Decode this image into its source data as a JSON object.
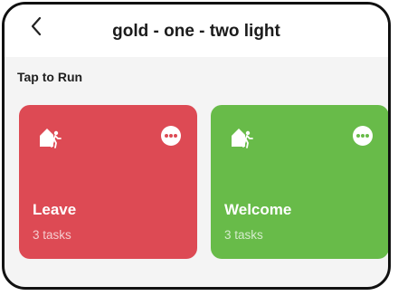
{
  "header": {
    "title": "gold - one - two light",
    "back_icon": "chevron-left-icon"
  },
  "section": {
    "label": "Tap to Run"
  },
  "scenes": [
    {
      "name": "Leave",
      "tasks": "3 tasks",
      "color": "#dd4a54",
      "icon": "home-walk-icon",
      "more_icon": "more-dots-icon"
    },
    {
      "name": "Welcome",
      "tasks": "3 tasks",
      "color": "#68bb49",
      "icon": "home-walk-icon",
      "more_icon": "more-dots-icon"
    }
  ],
  "colors": {
    "background": "#f4f4f4",
    "header": "#ffffff",
    "frame": "#111111"
  }
}
